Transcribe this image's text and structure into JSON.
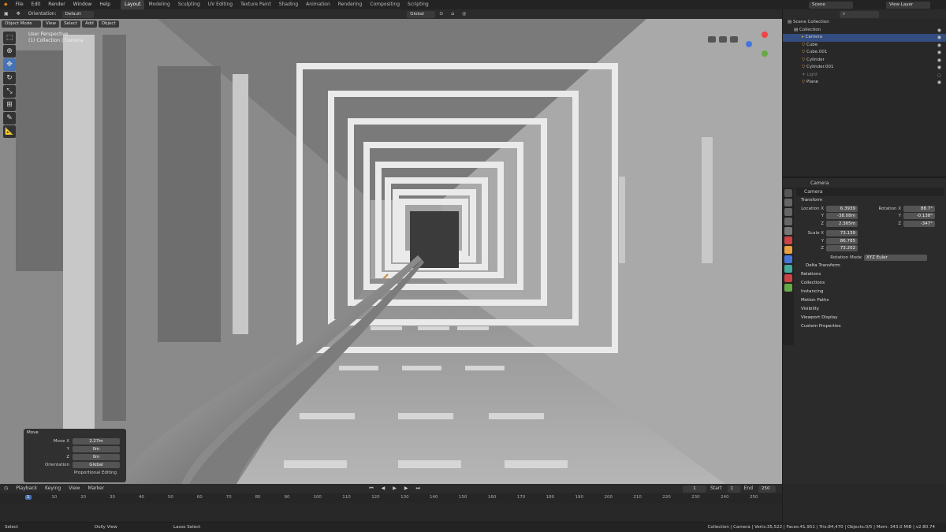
{
  "topbar": {
    "menus": [
      "File",
      "Edit",
      "Render",
      "Window",
      "Help"
    ],
    "workspaces": [
      "Layout",
      "Modeling",
      "Sculpting",
      "UV Editing",
      "Texture Paint",
      "Shading",
      "Animation",
      "Rendering",
      "Compositing",
      "Scripting"
    ],
    "scene": "Scene",
    "view_layer": "View Layer"
  },
  "viewport_header": {
    "orientation_label": "Orientation:",
    "orientation": "Default",
    "mode": "Object Mode",
    "menus": [
      "View",
      "Select",
      "Add",
      "Object"
    ],
    "transform_orientation": "Global"
  },
  "viewport_overlay": {
    "line1": "User Perspective",
    "line2": "(1) Collection | Camera"
  },
  "move_panel": {
    "title": "Move",
    "move_x_label": "Move X",
    "move_x": "2.27m",
    "y_label": "Y",
    "y": "0m",
    "z_label": "Z",
    "z": "0m",
    "orientation_label": "Orientation",
    "orientation": "Global",
    "proportional": "Proportional Editing"
  },
  "outliner": {
    "root": "Scene Collection",
    "collection": "Collection",
    "items": [
      "Camera",
      "Cube",
      "Cube.001",
      "Cylinder",
      "Cylinder.001",
      "Light",
      "Plane"
    ]
  },
  "properties": {
    "object_name": "Camera",
    "data_name": "Camera",
    "transform": "Transform",
    "location_label": "Location X",
    "location": [
      "6.3939",
      "-38.08m",
      "2.365m"
    ],
    "rotation_label": "Rotation X",
    "rotation": [
      "88.7°",
      "-0.138°",
      "-347°"
    ],
    "scale_label": "Scale X",
    "scale": [
      "73.139",
      "86.785",
      "73.202"
    ],
    "axis_y": "Y",
    "axis_z": "Z",
    "rotation_mode_label": "Rotation Mode",
    "rotation_mode": "XYZ Euler",
    "delta": "Delta Transform",
    "sections": [
      "Relations",
      "Collections",
      "Instancing",
      "Motion Paths",
      "Visibility",
      "Viewport Display",
      "Custom Properties"
    ]
  },
  "timeline": {
    "menus": [
      "Playback",
      "Keying",
      "View",
      "Marker"
    ],
    "current_frame": "1",
    "start_label": "Start",
    "start": "1",
    "end_label": "End",
    "end": "250",
    "ticks": [
      "1",
      "10",
      "20",
      "30",
      "40",
      "50",
      "60",
      "70",
      "80",
      "90",
      "100",
      "110",
      "120",
      "130",
      "140",
      "150",
      "160",
      "170",
      "180",
      "190",
      "200",
      "210",
      "220",
      "230",
      "240",
      "250"
    ]
  },
  "status": {
    "select": "Select",
    "dolly": "Dolly View",
    "lasso": "Lasso Select",
    "stats": "Collection | Camera | Verts:35,522 | Faces:41,951 | Tris:84,470 | Objects:0/5 | Mem: 343.0 MiB | v2.80.74"
  },
  "colors": {
    "accent": "#4772b3",
    "selected_row": "#334d80",
    "header": "#2b2b2b"
  }
}
